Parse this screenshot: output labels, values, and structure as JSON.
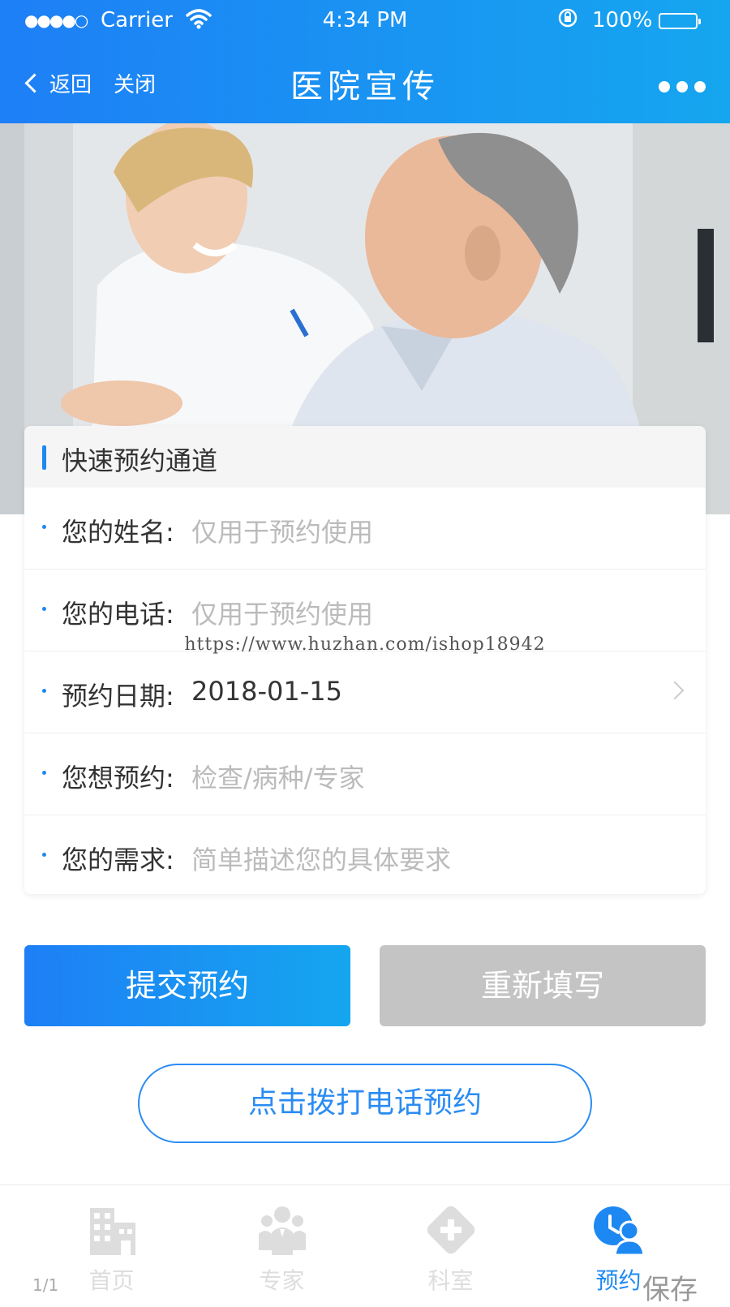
{
  "status_bar": {
    "signal": "●●●●○",
    "carrier": "Carrier",
    "time": "4:34 PM",
    "battery": "100%"
  },
  "nav": {
    "back_label": "返回",
    "close_label": "关闭",
    "title": "医院宣传"
  },
  "form": {
    "title": "快速预约通道",
    "fields": [
      {
        "label": "您的姓名:",
        "placeholder": "仅用于预约使用",
        "value": ""
      },
      {
        "label": "您的电话:",
        "placeholder": "仅用于预约使用",
        "value": ""
      },
      {
        "label": "预约日期:",
        "placeholder": "",
        "value": "2018-01-15"
      },
      {
        "label": "您想预约:",
        "placeholder": "检查/病种/专家",
        "value": ""
      },
      {
        "label": "您的需求:",
        "placeholder": "简单描述您的具体要求",
        "value": ""
      }
    ]
  },
  "watermark": "https://www.huzhan.com/ishop18942",
  "buttons": {
    "submit": "提交预约",
    "reset": "重新填写",
    "call": "点击拨打电话预约"
  },
  "tabbar": {
    "items": [
      {
        "label": "首页",
        "icon": "hospital-building-icon",
        "active": false
      },
      {
        "label": "专家",
        "icon": "experts-group-icon",
        "active": false
      },
      {
        "label": "科室",
        "icon": "medical-cross-icon",
        "active": false
      },
      {
        "label": "预约",
        "icon": "appointment-doctor-icon",
        "active": true
      }
    ]
  },
  "overlay": {
    "pager": "1/1",
    "save": "保存"
  },
  "colors": {
    "primary": "#1e7ff6",
    "primary_light": "#15a6ef",
    "reset_gray": "#c4c4c4",
    "tab_inactive": "#dddddd"
  }
}
